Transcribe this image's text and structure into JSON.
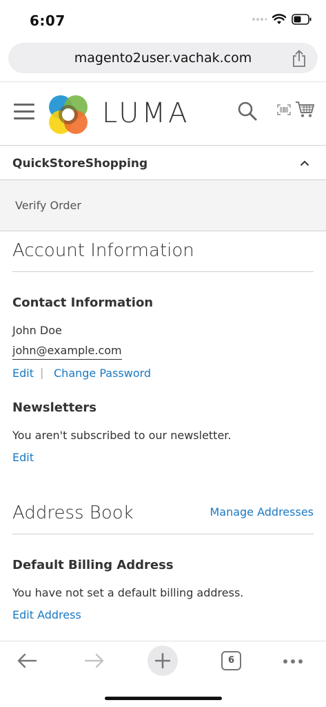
{
  "status_bar": {
    "time": "6:07"
  },
  "browser": {
    "url": "magento2user.vachak.com",
    "tab_count": "6"
  },
  "header": {
    "logo_text": "LUMA"
  },
  "store_switch": {
    "label": "QuickStoreShopping"
  },
  "verify": {
    "label": "Verify Order"
  },
  "account": {
    "title": "Account Information",
    "contact": {
      "title": "Contact Information",
      "name": "John Doe",
      "email": "john@example.com",
      "edit_label": "Edit",
      "separator": "|",
      "change_password_label": "Change Password"
    },
    "newsletters": {
      "title": "Newsletters",
      "status": "You aren't subscribed to our newsletter.",
      "edit_label": "Edit"
    }
  },
  "address_book": {
    "title": "Address Book",
    "manage_label": "Manage Addresses",
    "billing": {
      "title": "Default Billing Address",
      "status": "You have not set a default billing address.",
      "edit_label": "Edit Address"
    }
  },
  "colors": {
    "link": "#1979c3",
    "text": "#333333",
    "light_bg": "#f4f4f4"
  },
  "icons": [
    "wifi-icon",
    "battery-icon",
    "share-icon",
    "menu-icon",
    "search-icon",
    "barcode-icon",
    "cart-icon",
    "chevron-up-icon",
    "back-icon",
    "forward-icon",
    "plus-icon",
    "tabs-icon",
    "more-icon"
  ]
}
